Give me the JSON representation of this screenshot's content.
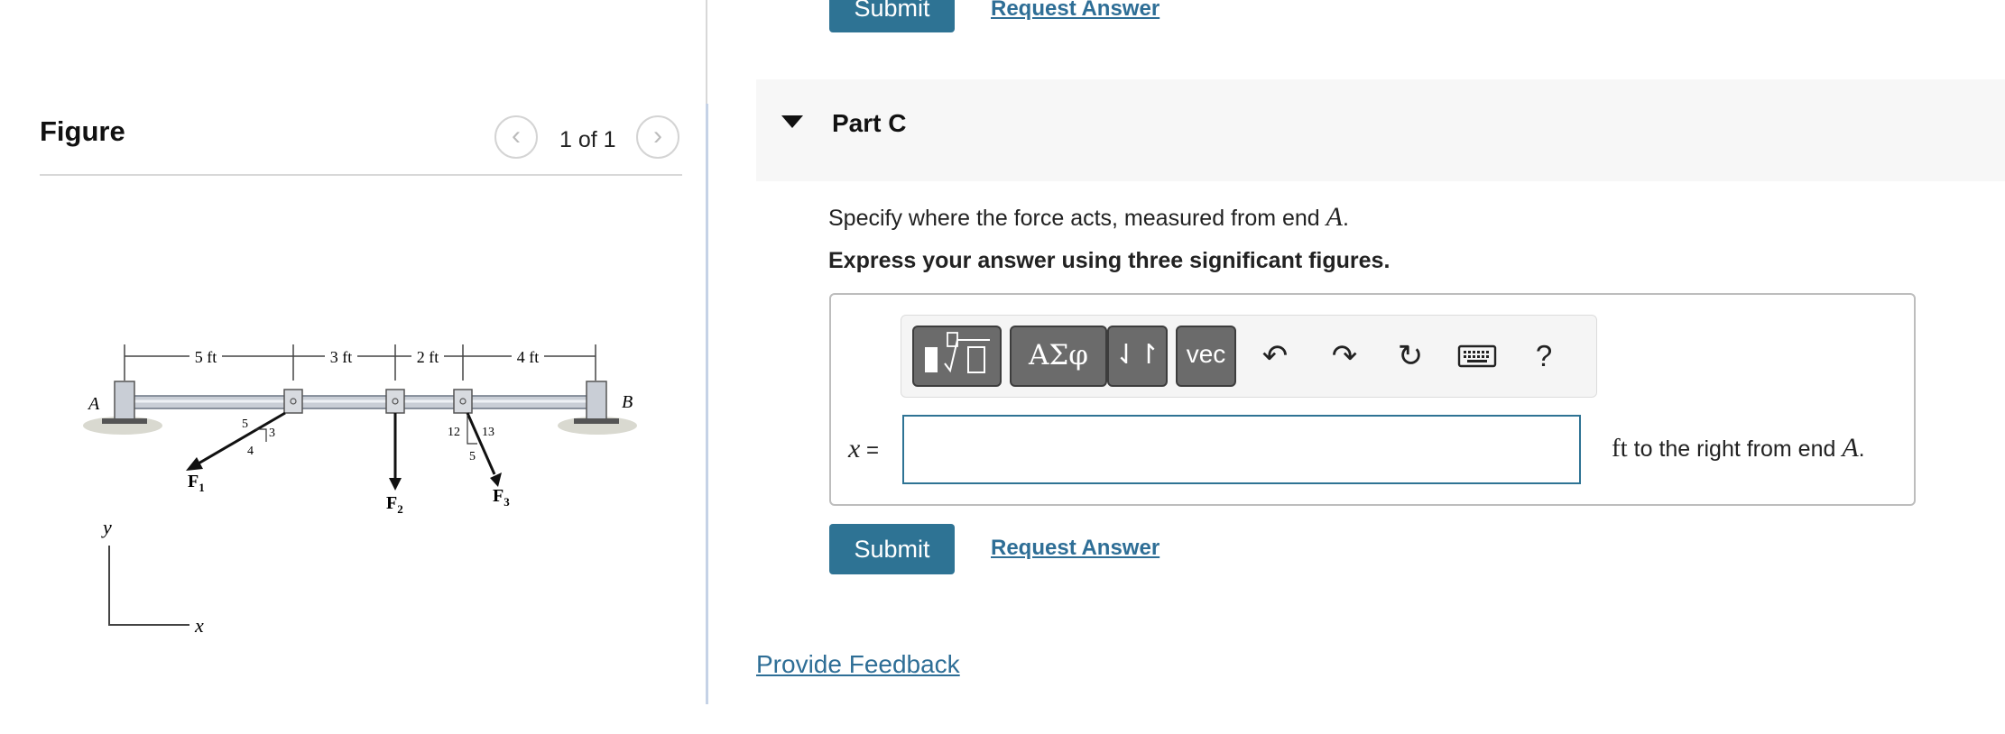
{
  "figure_panel": {
    "title": "Figure",
    "page_count": "1 of 1",
    "prev_icon": "chevron-left-icon",
    "next_icon": "chevron-right-icon",
    "diagram": {
      "dims": [
        "5 ft",
        "3 ft",
        "2 ft",
        "4 ft"
      ],
      "end_a": "A",
      "end_b": "B",
      "f1_slope": [
        "5",
        "3",
        "4"
      ],
      "f3_slope": [
        "12",
        "13",
        "5"
      ],
      "forces": [
        "F",
        "F",
        "F"
      ],
      "force_subs": [
        "1",
        "2",
        "3"
      ],
      "axis_y": "y",
      "axis_x": "x"
    }
  },
  "top_actions": {
    "submit": "Submit",
    "request": "Request Answer"
  },
  "part": {
    "title": "Part C",
    "question_prefix": "Specify where the force acts, measured from end ",
    "question_var": "A",
    "question_suffix": ".",
    "instruction": "Express your answer using three significant figures."
  },
  "toolbar": {
    "greek": "ΑΣφ",
    "arrows": "⇃↾",
    "vec": "vec",
    "undo": "↶",
    "redo": "↷",
    "reset": "↻",
    "help": "?"
  },
  "answer": {
    "var": "x",
    "eq": " =",
    "value": "",
    "unit": "ft",
    "unit_suffix": " to the right from end ",
    "unit_var": "A",
    "unit_end": "."
  },
  "actions": {
    "submit": "Submit",
    "request": "Request Answer"
  },
  "feedback": "Provide Feedback",
  "colors": {
    "accent": "#2e7394",
    "link": "#2e6e96",
    "toolbar_btn": "#6b6b6b"
  }
}
